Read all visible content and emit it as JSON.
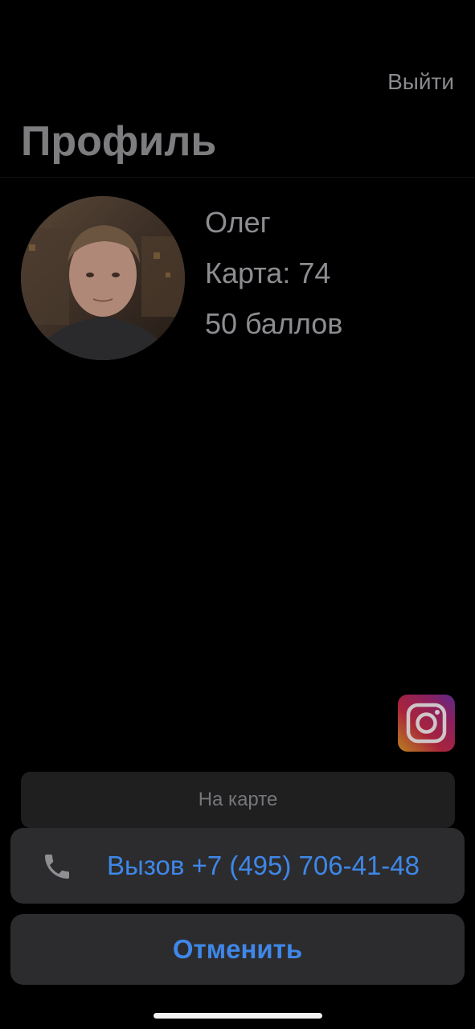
{
  "header": {
    "logout_label": "Выйти",
    "title": "Профиль"
  },
  "profile": {
    "avatar_icon": "user-photo",
    "name": "Олег",
    "card": "Карта: 74",
    "points": "50 баллов"
  },
  "social": {
    "instagram_icon": "instagram-icon"
  },
  "actions": {
    "map_label": "На карте",
    "call_label": "Вызов +7 (495) 706-41-48",
    "call_icon": "phone-icon",
    "cancel_label": "Отменить"
  },
  "colors": {
    "accent": "#3f87e8",
    "sheet_background": "#2c2c2e",
    "background": "#000000"
  }
}
